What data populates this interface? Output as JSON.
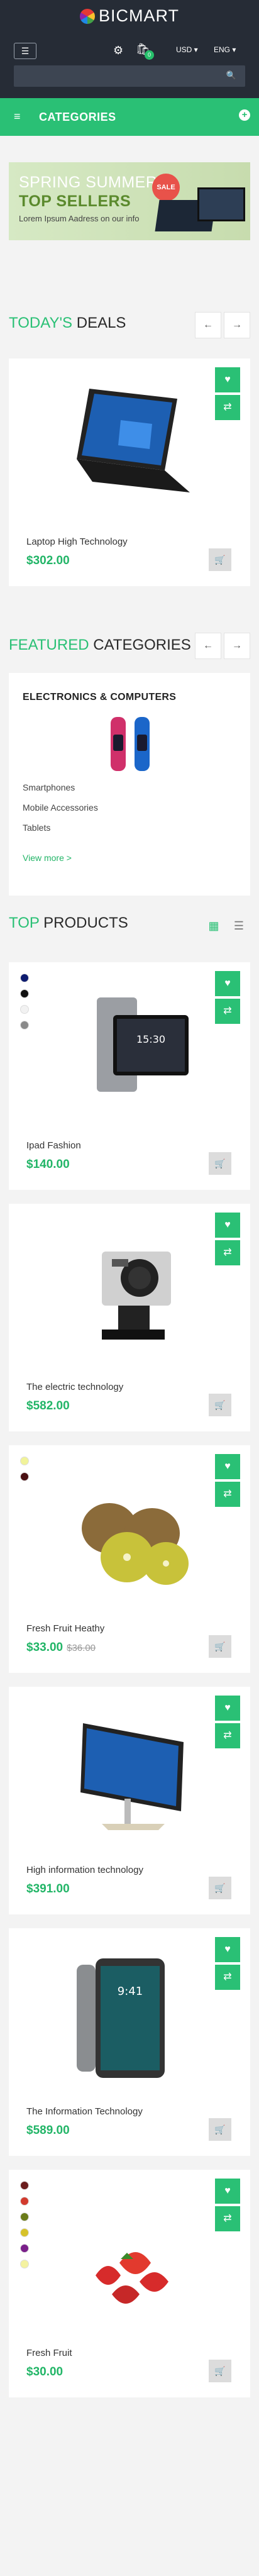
{
  "header": {
    "brand": "BICMART",
    "menu_icon": "menu-icon",
    "settings_icon": "gear-icon",
    "cart_icon": "shopping-bag-icon",
    "cart_count": "0",
    "currency": "USD ▾",
    "language": "ENG ▾",
    "search_placeholder": ""
  },
  "categories_bar": {
    "label": "CATEGORIES"
  },
  "banner": {
    "line1": "SPRING SUMMER",
    "line2": "TOP SELLERS",
    "line3": "Lorem Ipsum Aadress on our info",
    "badge": "SALE"
  },
  "todays_deals": {
    "title_accent": "TODAY'S",
    "title_rest": " DEALS",
    "product": {
      "name": "Laptop High Technology",
      "price": "$302.00"
    }
  },
  "featured": {
    "title_accent": "FEATURED",
    "title_rest": " CATEGORIES",
    "card_title": "ELECTRONICS & COMPUTERS",
    "links": [
      "Smartphones",
      "Mobile Accessories",
      "Tablets"
    ],
    "view_more": "View more >"
  },
  "top_products": {
    "title_accent": "TOP",
    "title_rest": " PRODUCTS",
    "items": [
      {
        "name": "Ipad Fashion",
        "price": "$140.00",
        "old_price": "",
        "colors": [
          "#0d1b6f",
          "#111111",
          "#f2f2f2",
          "#8a8a8a"
        ]
      },
      {
        "name": "The electric technology",
        "price": "$582.00",
        "old_price": "",
        "colors": []
      },
      {
        "name": "Fresh Fruit Heathy",
        "price": "$33.00",
        "old_price": "$36.00",
        "colors": [
          "#f1f39a",
          "#4a0f12"
        ]
      },
      {
        "name": "High information technology",
        "price": "$391.00",
        "old_price": "",
        "colors": []
      },
      {
        "name": "The Information Technology",
        "price": "$589.00",
        "old_price": "",
        "colors": []
      },
      {
        "name": "Fresh Fruit",
        "price": "$30.00",
        "old_price": "",
        "colors": [
          "#6a1d1d",
          "#d23b2e",
          "#6b7c1a",
          "#d6c22a",
          "#7a1f8a",
          "#f4f2a0"
        ]
      }
    ]
  },
  "accent_color": "#2ac075"
}
